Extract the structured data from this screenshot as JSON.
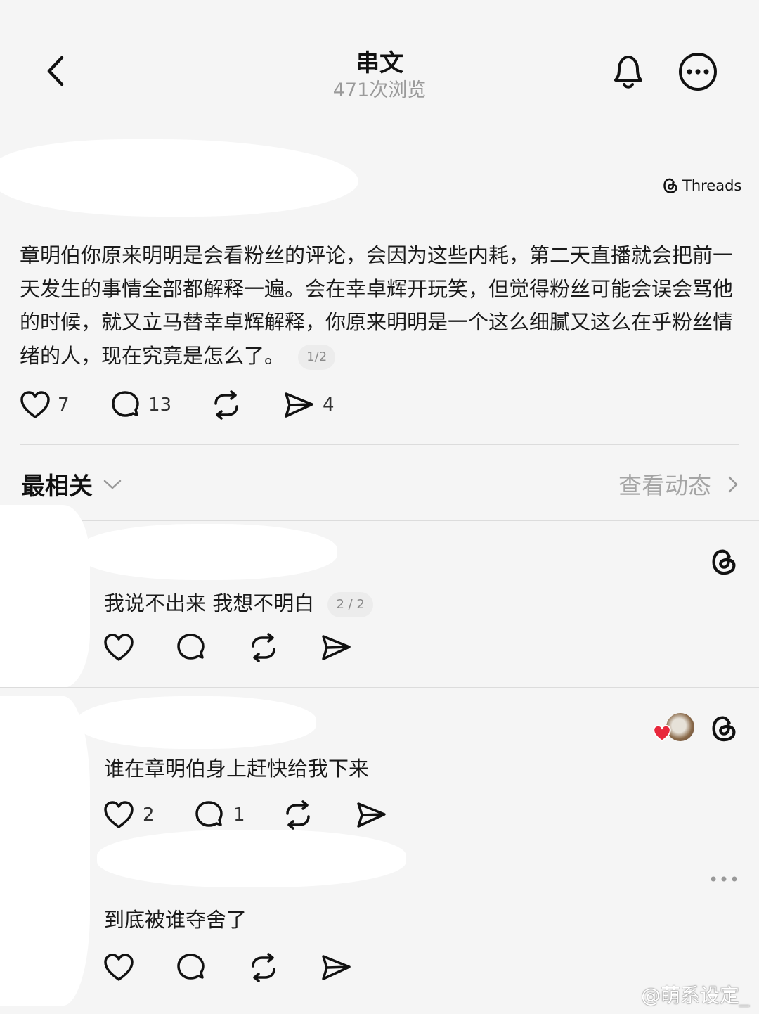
{
  "header": {
    "title": "串文",
    "views": "471次浏览"
  },
  "post": {
    "brand": "Threads",
    "text": "章明伯你原来明明是会看粉丝的评论，会因为这些内耗，第二天直播就会把前一天发生的事情全部都解释一遍。会在幸卓辉开玩笑，但觉得粉丝可能会误会骂他的时候，就又立马替幸卓辉解释，你原来明明是一个这么细腻又这么在乎粉丝情绪的人，现在究竟是怎么了。",
    "page": "1/2",
    "likes": "7",
    "comments": "13",
    "shares": "4"
  },
  "sort": {
    "label": "最相关",
    "activity": "查看动态"
  },
  "replies": [
    {
      "text": "我说不出来 我想不明白",
      "page": "2 / 2",
      "likes": "",
      "comments": ""
    },
    {
      "text": "谁在章明伯身上赶快给我下来",
      "likes": "2",
      "comments": "1"
    },
    {
      "text": "到底被谁夺舍了"
    }
  ],
  "watermark": "@萌系设定_",
  "icons": [
    "back-icon",
    "bell-icon",
    "more-icon",
    "threads-logo-icon",
    "heart-icon",
    "comment-icon",
    "repost-icon",
    "share-icon",
    "chevron-down-icon",
    "chevron-right-icon",
    "ellipsis-icon",
    "liked-heart-icon",
    "avatar"
  ],
  "colors": {
    "background": "#f5f5f5",
    "text": "#111111",
    "muted": "#9a9a9a",
    "like_red": "#e8283c"
  }
}
